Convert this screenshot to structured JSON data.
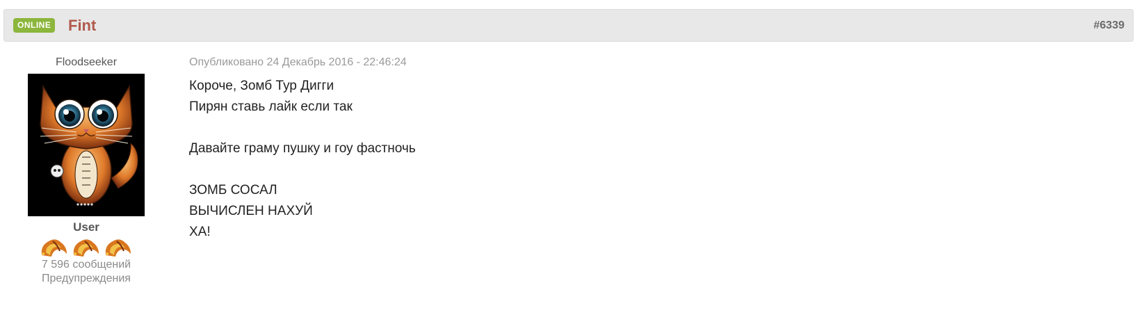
{
  "header": {
    "status_badge": "ONLINE",
    "author_name": "Fint",
    "post_number": "#6339",
    "badge_color": "#8cb63c",
    "author_color": "#b05a4d"
  },
  "author": {
    "group_title": "Floodseeker",
    "avatar_icon": "cat-avatar",
    "rank": "User",
    "rank_icon": "flame-rank-icon",
    "rank_icon_count": 3,
    "post_count": "7 596 сообщений",
    "warnings_label": "Предупреждения"
  },
  "post": {
    "date": "Опубликовано 24 Декабрь 2016 - 22:46:24",
    "lines": [
      "Короче, Зомб Тур Дигги",
      "Пирян ставь лайк если так",
      "",
      "Давайте граму пушку и гоу фастночь",
      "",
      "ЗОМБ СОСАЛ",
      "ВЫЧИСЛЕН НАХУЙ",
      "ХА!"
    ]
  }
}
